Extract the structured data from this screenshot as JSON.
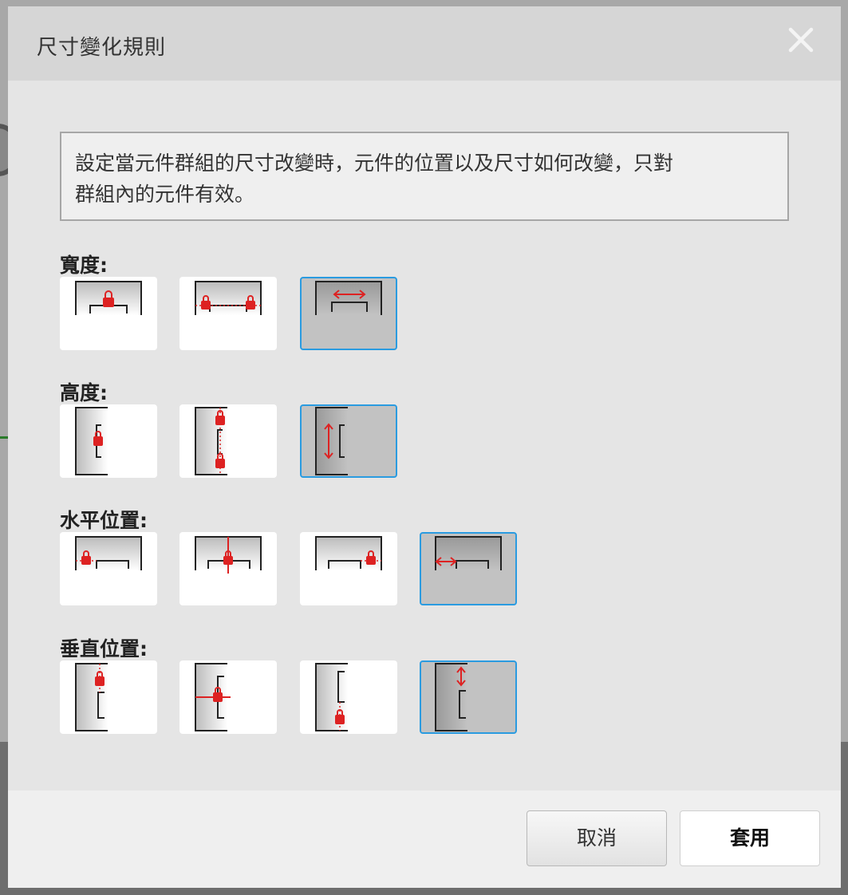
{
  "dialog": {
    "title": "尺寸變化規則",
    "description_line1": "設定當元件群組的尺寸改變時，元件的位置以及尺寸如何改變，只對",
    "description_line2": "群組內的元件有效。"
  },
  "sections": {
    "width": {
      "label": "寬度:",
      "options": [
        "lock-center-icon",
        "lock-both-sides-icon",
        "stretch-horizontal-icon"
      ],
      "selected_index": 2
    },
    "height": {
      "label": "高度:",
      "options": [
        "lock-middle-icon",
        "lock-top-bottom-icon",
        "stretch-vertical-icon"
      ],
      "selected_index": 2
    },
    "horizontal_position": {
      "label": "水平位置:",
      "options": [
        "anchor-left-icon",
        "anchor-center-icon",
        "anchor-right-icon",
        "scale-horizontal-icon"
      ],
      "selected_index": 3
    },
    "vertical_position": {
      "label": "垂直位置:",
      "options": [
        "anchor-top-icon",
        "anchor-middle-icon",
        "anchor-bottom-icon",
        "scale-vertical-icon"
      ],
      "selected_index": 3
    }
  },
  "footer": {
    "cancel_label": "取消",
    "apply_label": "套用"
  },
  "colors": {
    "accent_red": "#dd2222",
    "selected_border": "#2a9be0"
  }
}
